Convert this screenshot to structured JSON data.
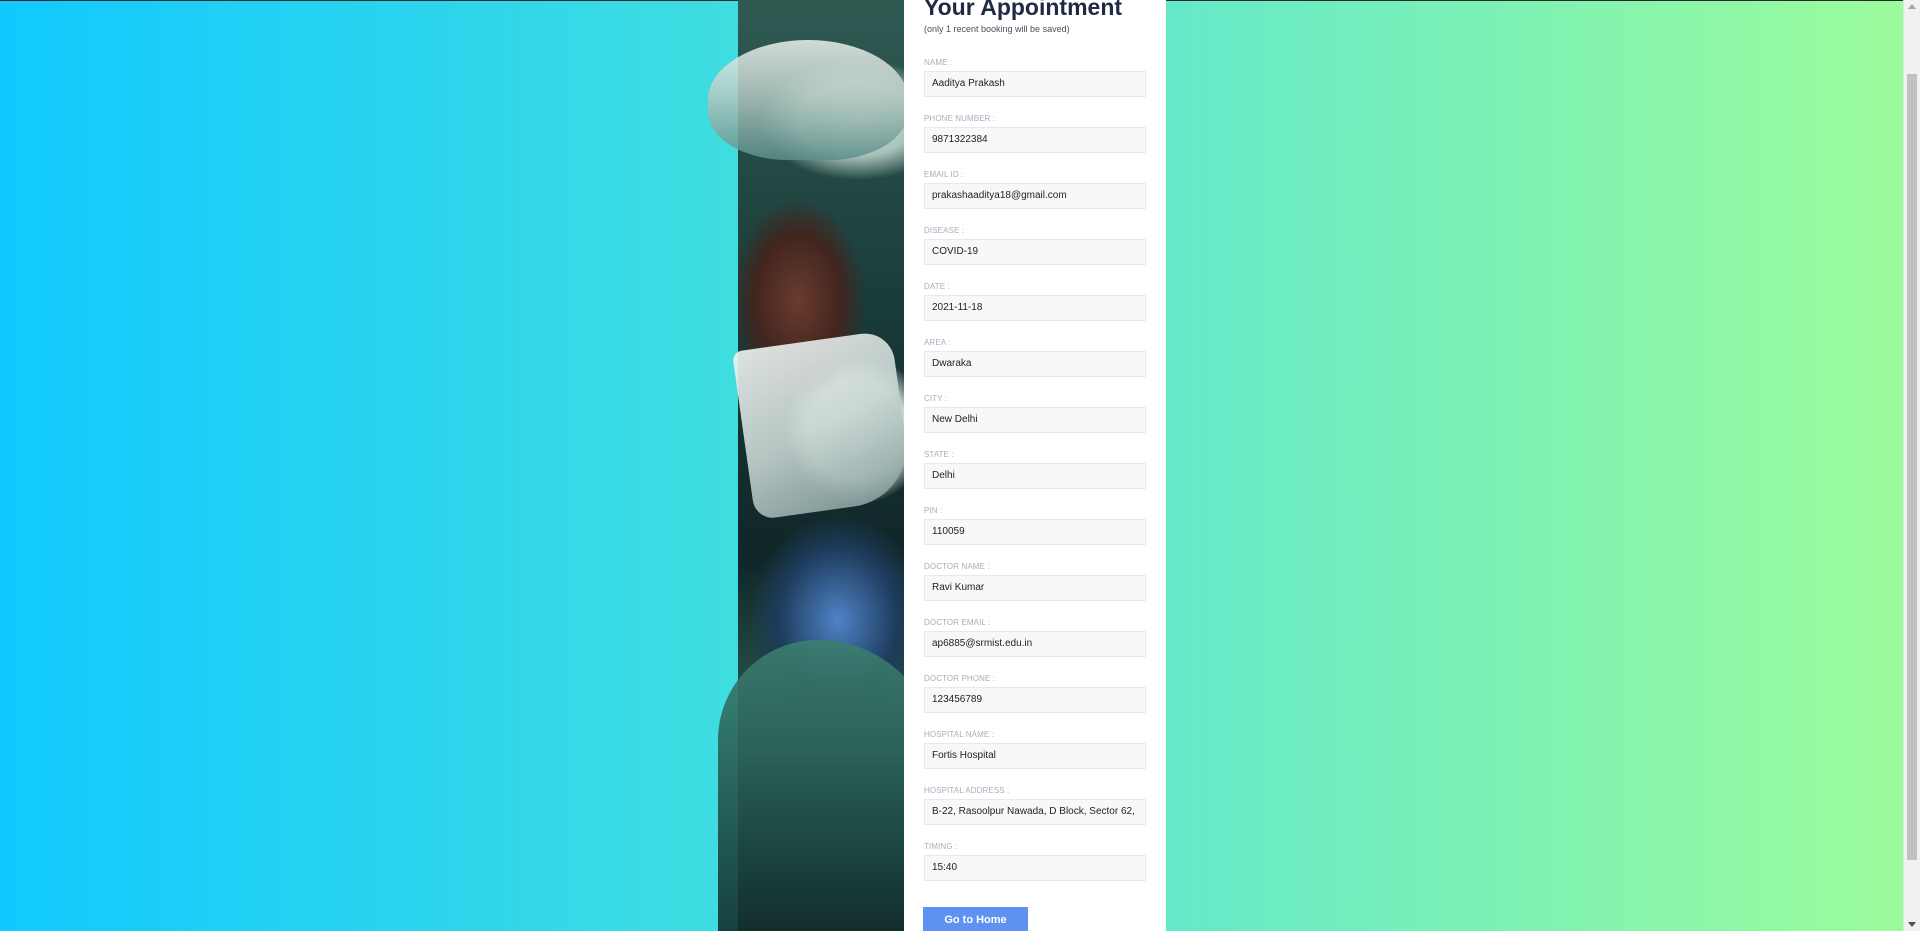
{
  "appointment": {
    "title": "Your Appointment",
    "subtitle": "(only 1 recent booking will be saved)",
    "fields": [
      {
        "label": "NAME :",
        "value": "Aaditya Prakash"
      },
      {
        "label": "PHONE NUMBER :",
        "value": "9871322384"
      },
      {
        "label": "EMAIL ID :",
        "value": "prakashaaditya18@gmail.com"
      },
      {
        "label": "DISEASE :",
        "value": "COVID-19"
      },
      {
        "label": "DATE :",
        "value": "2021-11-18"
      },
      {
        "label": "AREA :",
        "value": "Dwaraka"
      },
      {
        "label": "CITY :",
        "value": "New Delhi"
      },
      {
        "label": "STATE :",
        "value": "Delhi"
      },
      {
        "label": "PIN :",
        "value": "110059"
      },
      {
        "label": "DOCTOR NAME :",
        "value": "Ravi Kumar"
      },
      {
        "label": "DOCTOR EMAIL :",
        "value": "ap6885@srmist.edu.in"
      },
      {
        "label": "DOCTOR PHONE :",
        "value": "123456789"
      },
      {
        "label": "HOSPITAL NAME :",
        "value": "Fortis Hospital"
      },
      {
        "label": "HOSPITAL ADDRESS :",
        "value": "B-22, Rasoolpur Nawada, D Block, Sector 62,"
      },
      {
        "label": "TIMING :",
        "value": "15:40"
      }
    ],
    "home_button_label": "Go to Home"
  },
  "colors": {
    "gradient_left": "#10c9ff",
    "gradient_right": "#9dfc9a",
    "button": "#5f92f0",
    "title": "#1f2a44"
  }
}
